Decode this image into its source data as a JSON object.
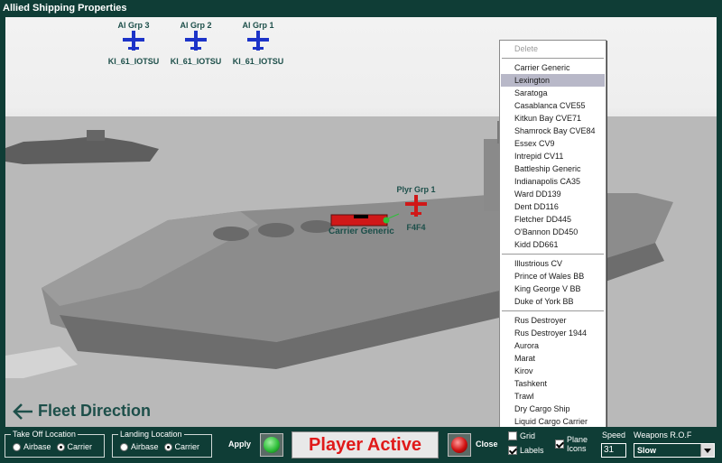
{
  "window": {
    "title": "Allied Shipping Properties"
  },
  "groups": [
    {
      "label": "Al Grp 3",
      "type": "KI_61_IOTSU"
    },
    {
      "label": "Al Grp 2",
      "type": "KI_61_IOTSU"
    },
    {
      "label": "Al Grp 1",
      "type": "KI_61_IOTSU"
    }
  ],
  "player_group": {
    "label": "Plyr Grp 1",
    "type": "F4F4"
  },
  "carrier_label": "Carrier Generic",
  "fleet_direction": "Fleet Direction",
  "menu": {
    "delete": "Delete",
    "section1": [
      "Carrier Generic",
      "Lexington",
      "Saratoga",
      "Casablanca CVE55",
      "Kitkun Bay CVE71",
      "Shamrock Bay CVE84",
      "Essex CV9",
      "Intrepid CV11",
      "Battleship Generic",
      "Indianapolis CA35",
      "Ward DD139",
      "Dent DD116",
      "Fletcher DD445",
      "O'Bannon DD450",
      "Kidd DD661"
    ],
    "section2": [
      "Illustrious CV",
      "Prince of Wales BB",
      "King George V BB",
      "Duke of York BB"
    ],
    "section3": [
      "Rus Destroyer",
      "Rus Destroyer 1944",
      "Aurora",
      "Marat",
      "Kirov",
      "Tashkent",
      "Trawl",
      "Dry Cargo Ship",
      "Liquid Cargo Carrier"
    ],
    "selected": "Lexington"
  },
  "bottom": {
    "takeoff": {
      "legend": "Take Off Location",
      "opt1": "Airbase",
      "opt2": "Carrier",
      "selected": "Carrier"
    },
    "landing": {
      "legend": "Landing Location",
      "opt1": "Airbase",
      "opt2": "Carrier",
      "selected": "Carrier"
    },
    "apply": "Apply",
    "status": "Player Active",
    "close": "Close",
    "grid": "Grid",
    "labels": "Labels",
    "plane_icons_1": "Plane",
    "plane_icons_2": "Icons",
    "speed_label": "Speed",
    "speed_value": "31",
    "rof_label": "Weapons R.O.F",
    "rof_value": "Slow"
  },
  "colors": {
    "bg": "#0f3d36",
    "status_text": "#e01a1a",
    "apply_light": "#2fbf3a",
    "close_light": "#d01010"
  }
}
